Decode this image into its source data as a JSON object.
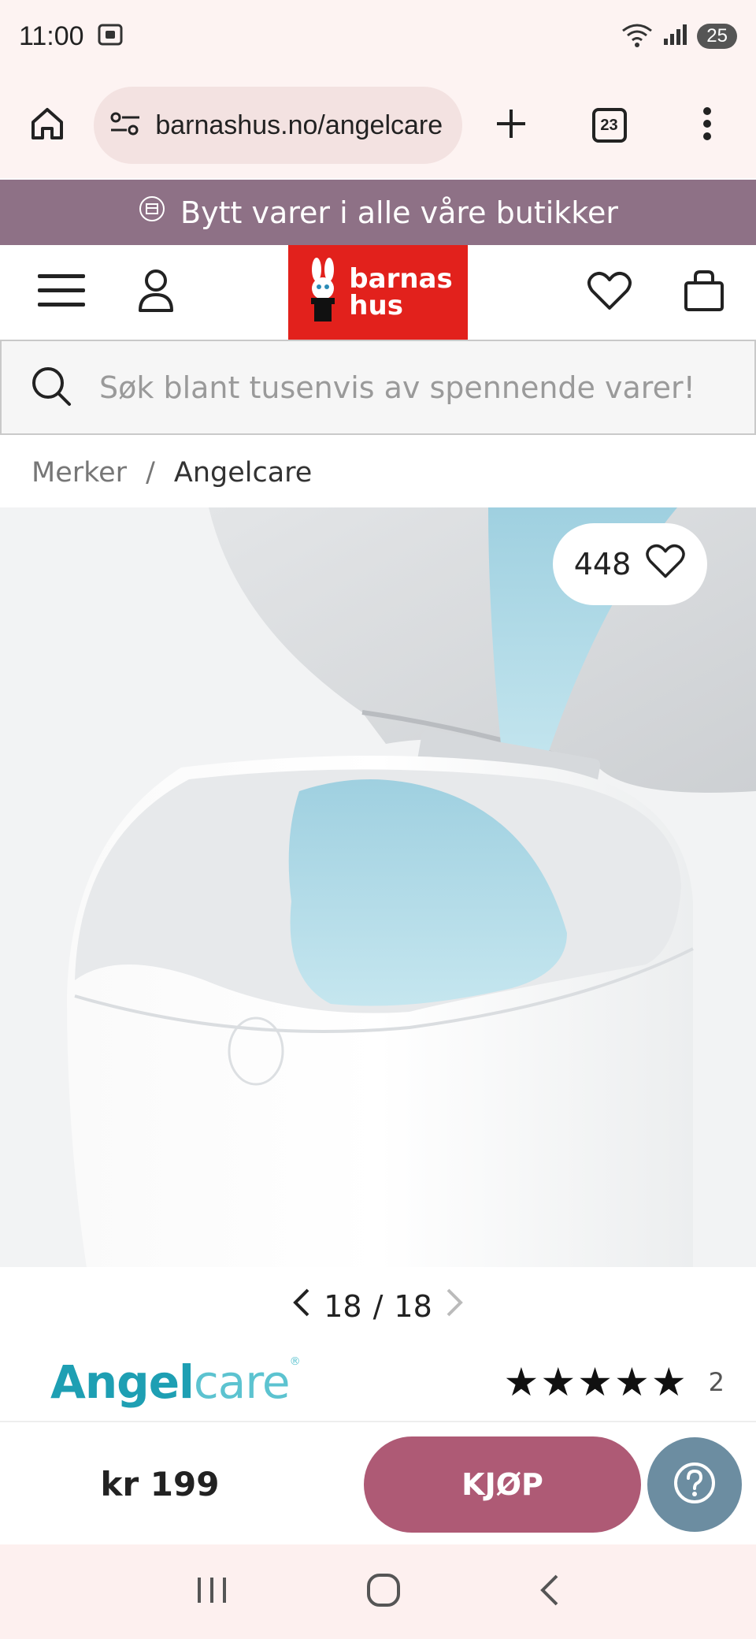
{
  "status_bar": {
    "time": "11:00",
    "battery": "25"
  },
  "browser": {
    "url": "barnashus.no/angelcare",
    "tab_count": "23"
  },
  "promo": {
    "text": "Bytt varer i alle våre butikker"
  },
  "logo": {
    "line1": "barnas",
    "line2": "hus"
  },
  "search": {
    "placeholder": "Søk blant tusenvis av spennende varer!"
  },
  "breadcrumb": {
    "items": [
      "Merker",
      "Angelcare"
    ],
    "separator": "/"
  },
  "product": {
    "favorites_count": "448",
    "pager": {
      "current": "18",
      "separator": "/",
      "total": "18"
    },
    "brand": {
      "part1": "Angel",
      "part2": "care",
      "mark": "®"
    },
    "rating": {
      "stars": "★★★★★",
      "count": "2"
    },
    "price": "kr 199",
    "buy_label": "KJØP"
  },
  "icons": {
    "home": "home-icon",
    "settings": "tune-icon",
    "add": "plus-icon",
    "menu": "more-vert-icon",
    "hamburger": "hamburger-icon",
    "account": "user-icon",
    "wishlist": "heart-icon",
    "cart": "bag-icon",
    "search": "search-icon",
    "help": "question-icon"
  },
  "colors": {
    "promo_bg": "#8e7186",
    "logo_bg": "#e2211c",
    "buy_bg": "#ae5a75",
    "help_bg": "#6c8da1",
    "brand": "#1e9fb3"
  }
}
